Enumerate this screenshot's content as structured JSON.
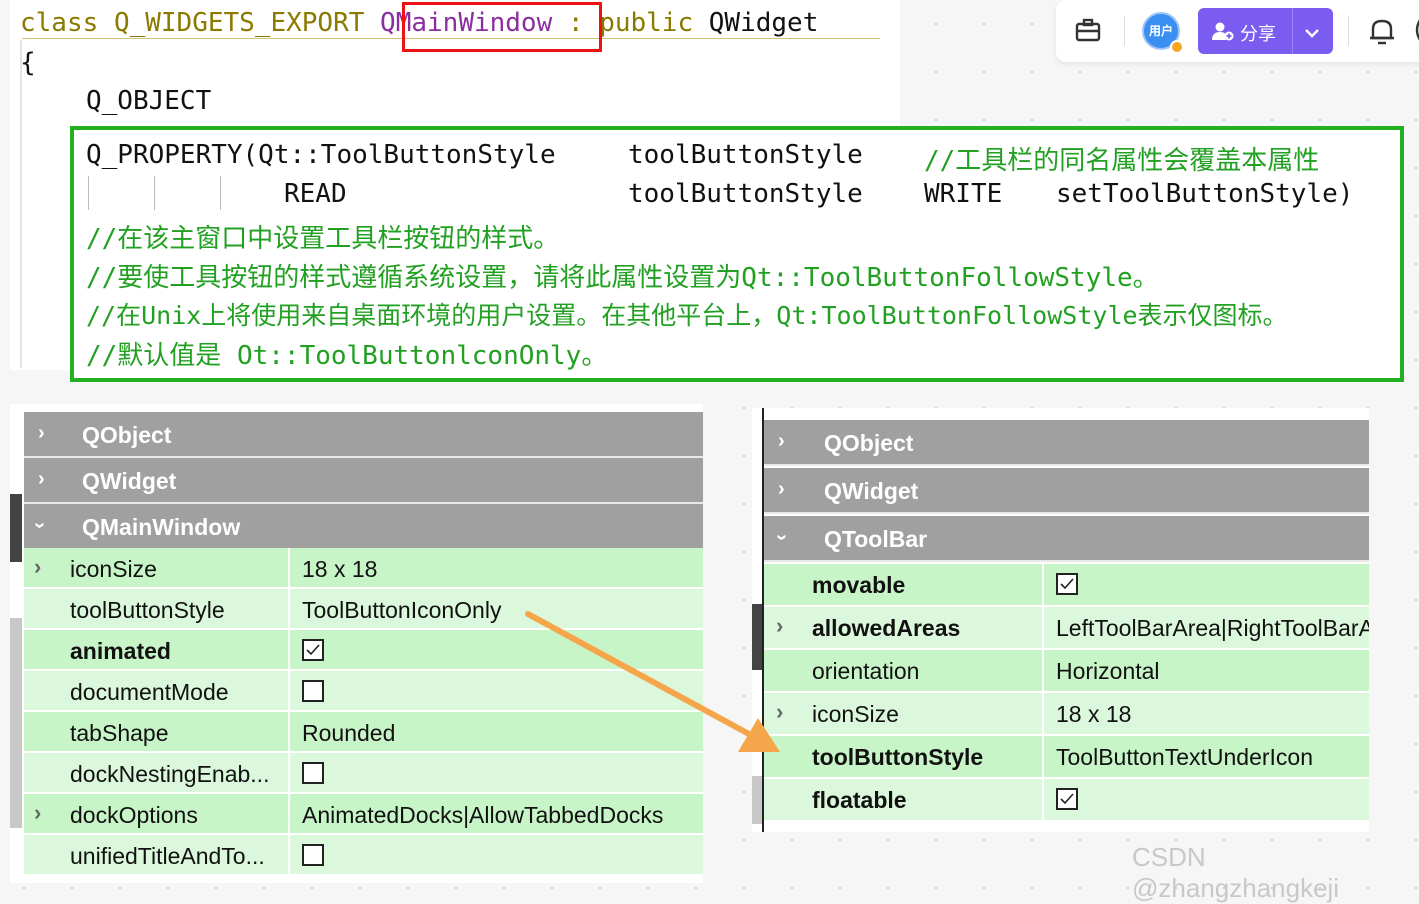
{
  "code": {
    "line1": {
      "kw_class": "class",
      "export": "Q_WIDGETS_EXPORT",
      "classname": "QMainWindow",
      "kw_public": ": public",
      "base": "QWidget"
    },
    "line2": "{",
    "line3": "Q_OBJECT",
    "property": {
      "line1_a": "Q_PROPERTY(Qt::ToolButtonStyle",
      "line1_b": "toolButtonStyle",
      "line1_comment": "//工具栏的同名属性会覆盖本属性",
      "line2_read": "READ",
      "line2_b": "toolButtonStyle",
      "line2_write": "WRITE",
      "line2_setter": "setToolButtonStyle)",
      "comment1": "//在该主窗口中设置工具栏按钮的样式。",
      "comment2": "//要使工具按钮的样式遵循系统设置，请将此属性设置为Qt::ToolButtonFollowStyle。",
      "comment3": "//在Unix上将使用来自桌面环境的用户设置。在其他平台上，Qt:ToolButtonFollowStyle表示仅图标。",
      "comment4": "//默认值是 Ot::ToolButtonlconOnly。"
    }
  },
  "topbar": {
    "toolbox_icon": "briefcase-icon",
    "avatar_text": "用户",
    "share_label": "分享",
    "bell_icon": "bell-icon",
    "accent": "#7b5cf0"
  },
  "left_panel": {
    "groups": [
      "QObject",
      "QWidget",
      "QMainWindow"
    ],
    "rows": [
      {
        "name": "iconSize",
        "value": "18 x 18"
      },
      {
        "name": "toolButtonStyle",
        "value": "ToolButtonIconOnly"
      },
      {
        "name": "animated",
        "value": ""
      },
      {
        "name": "documentMode",
        "value": ""
      },
      {
        "name": "tabShape",
        "value": "Rounded"
      },
      {
        "name": "dockNestingEnab...",
        "value": ""
      },
      {
        "name": "dockOptions",
        "value": "AnimatedDocks|AllowTabbedDocks"
      },
      {
        "name": "unifiedTitleAndTo...",
        "value": ""
      }
    ]
  },
  "right_panel": {
    "groups": [
      "QObject",
      "QWidget",
      "QToolBar"
    ],
    "rows": [
      {
        "name": "movable",
        "value": ""
      },
      {
        "name": "allowedAreas",
        "value": "LeftToolBarArea|RightToolBarArea"
      },
      {
        "name": "orientation",
        "value": "Horizontal"
      },
      {
        "name": "iconSize",
        "value": "18 x 18"
      },
      {
        "name": "toolButtonStyle",
        "value": "ToolButtonTextUnderIcon"
      },
      {
        "name": "floatable",
        "value": ""
      }
    ]
  },
  "watermark": "CSDN @zhangzhangkeji",
  "colors": {
    "highlight_red": "#ee1111",
    "highlight_green": "#22b022",
    "arrow": "#f5a54a",
    "row_green": "#c8f5c8"
  }
}
